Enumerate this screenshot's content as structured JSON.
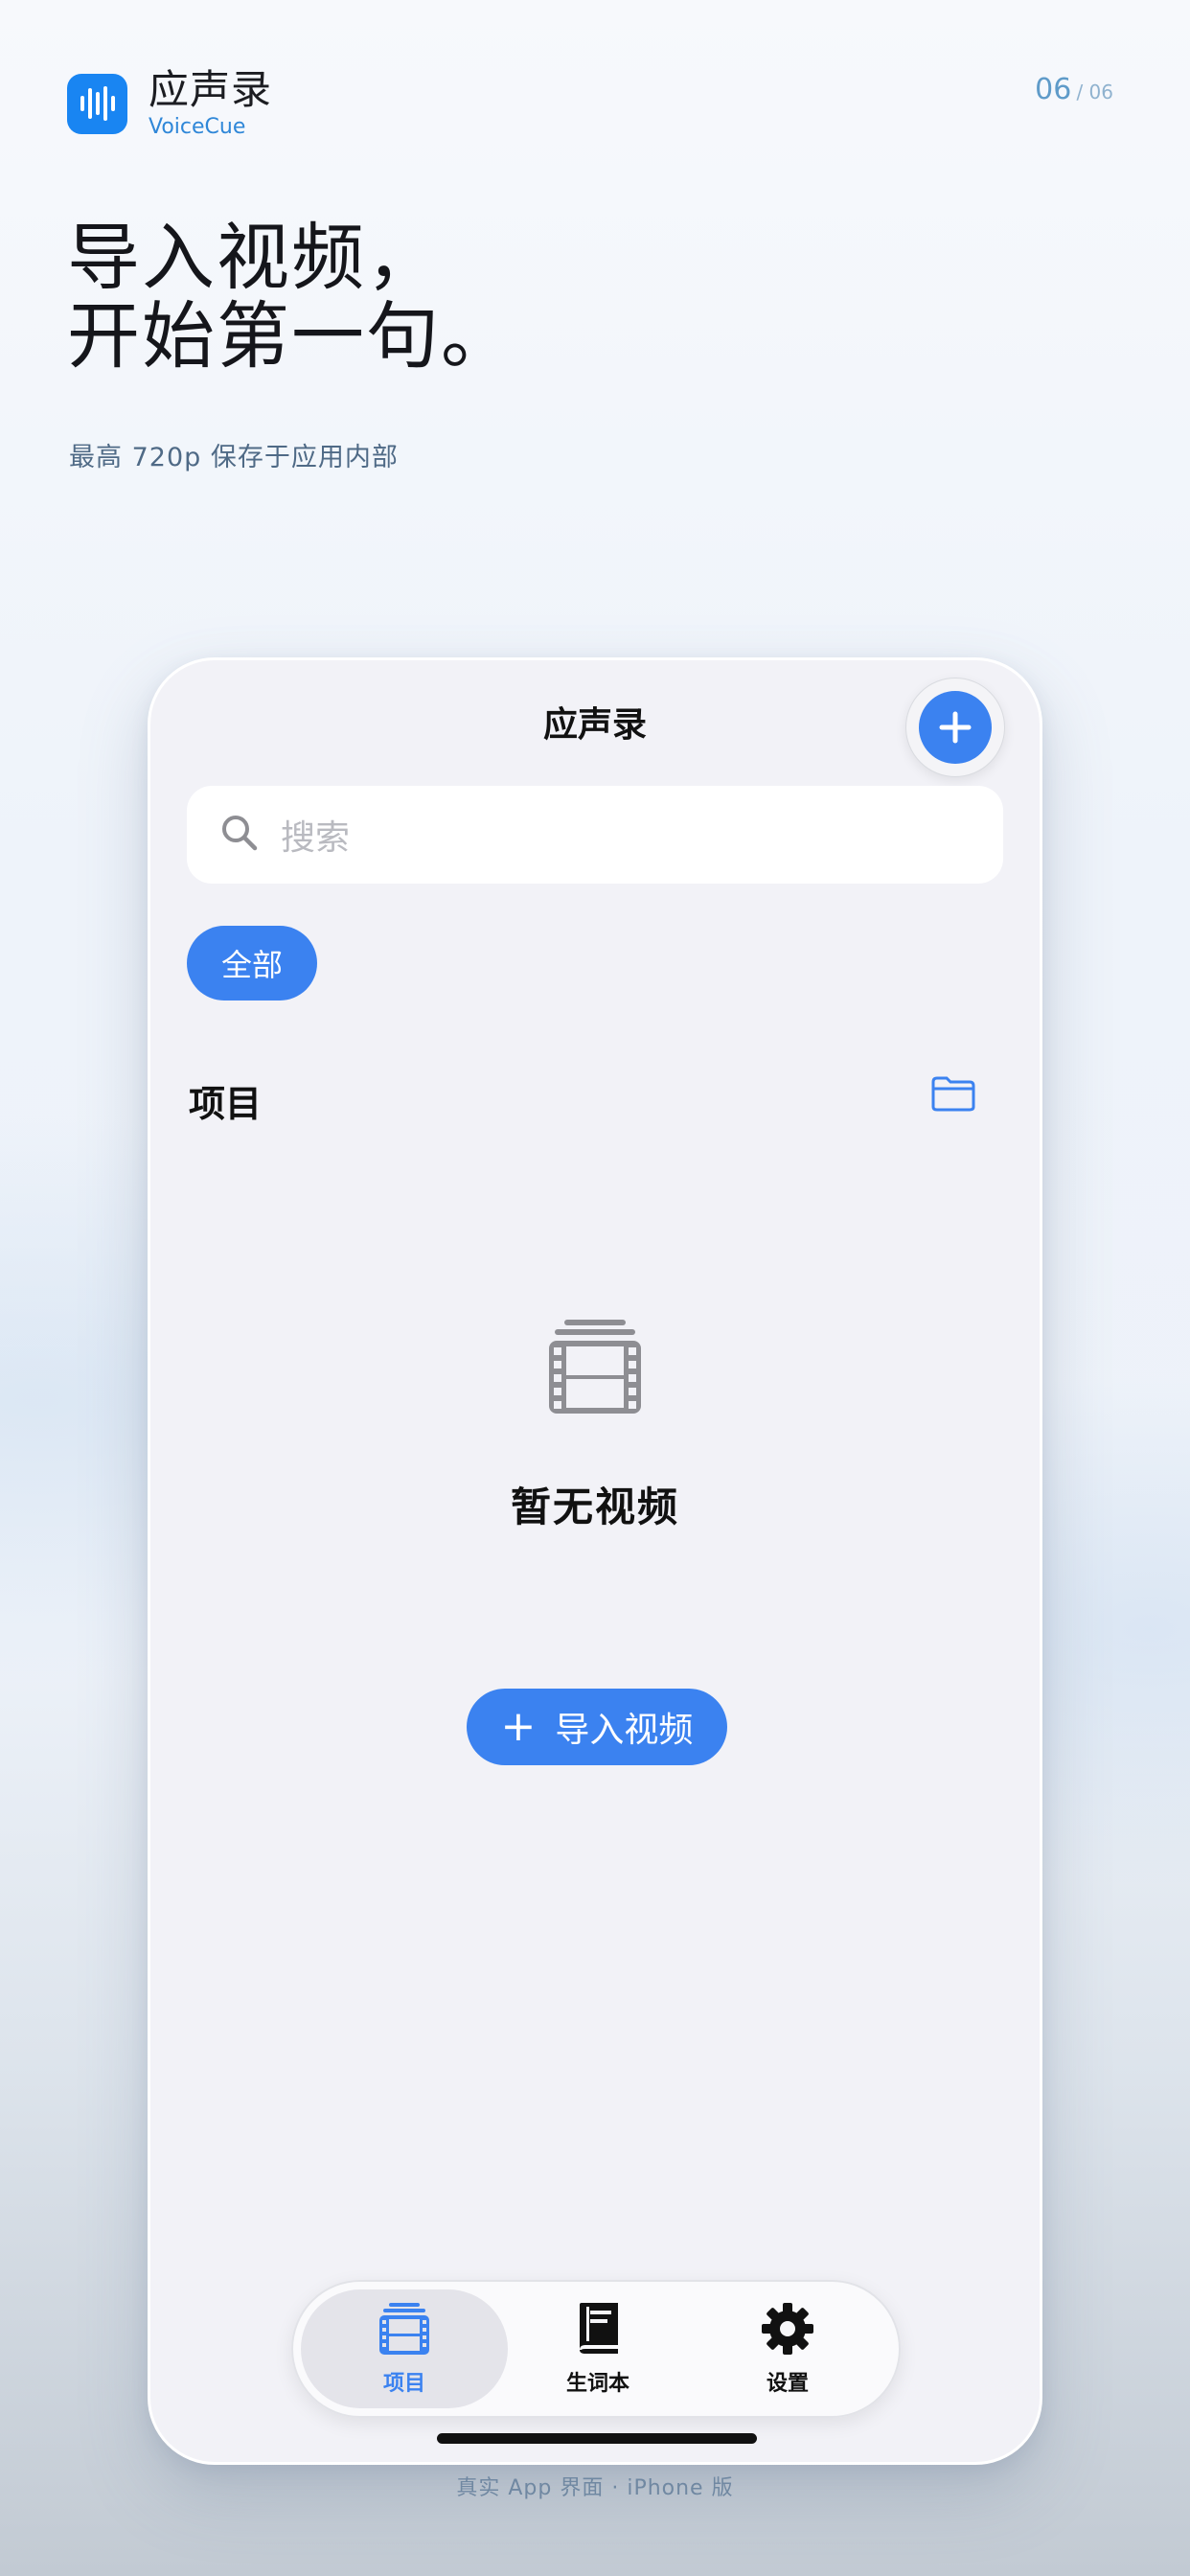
{
  "header": {
    "app_name": "应声录",
    "app_subtitle": "VoiceCue",
    "page_current": "06",
    "page_total": "/ 06"
  },
  "hero": {
    "headline_line1": "导入视频，",
    "headline_line2": "开始第一句。",
    "subline": "最高 720p 保存于应用内部"
  },
  "app": {
    "nav_title": "应声录",
    "search_placeholder": "搜索",
    "filter_chip": "全部",
    "section_title": "项目",
    "empty_text": "暂无视频",
    "import_button": "导入视频",
    "import_plus": "+",
    "tabs": [
      {
        "label": "项目",
        "icon": "film-stack-icon",
        "active": true
      },
      {
        "label": "生词本",
        "icon": "book-icon",
        "active": false
      },
      {
        "label": "设置",
        "icon": "gear-icon",
        "active": false
      }
    ]
  },
  "footer": "真实 App 界面 · iPhone 版",
  "colors": {
    "accent": "#3b82f0",
    "brand_icon": "#1985f2",
    "background": "#f2f2f7"
  }
}
